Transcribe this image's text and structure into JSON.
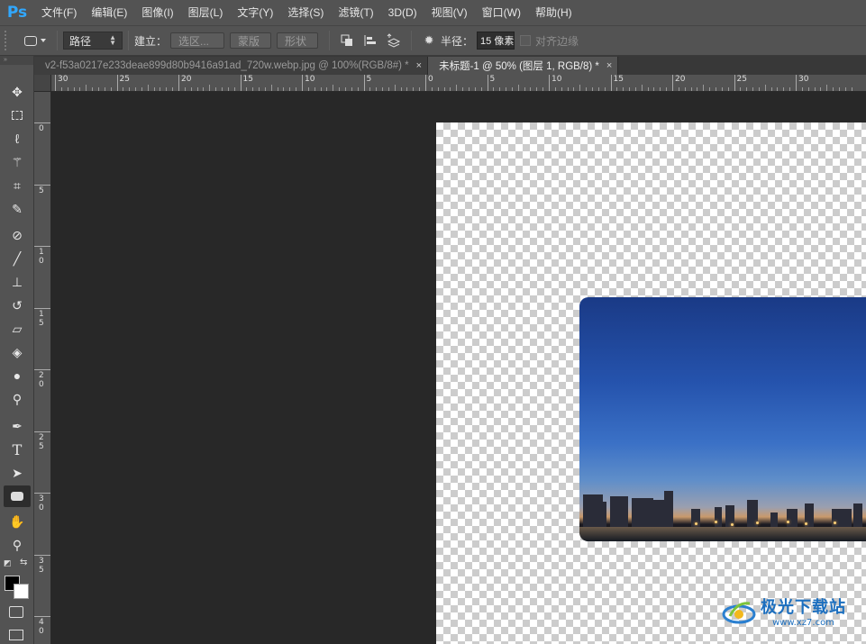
{
  "app": {
    "logo": "Ps"
  },
  "menu": [
    "文件(F)",
    "编辑(E)",
    "图像(I)",
    "图层(L)",
    "文字(Y)",
    "选择(S)",
    "滤镜(T)",
    "3D(D)",
    "视图(V)",
    "窗口(W)",
    "帮助(H)"
  ],
  "options": {
    "mode_value": "路径",
    "make_label": "建立：",
    "selection_btn": "选区...",
    "mask_btn": "蒙版",
    "shape_btn": "形状",
    "radius_label": "半径：",
    "radius_value": "15 像素",
    "align_edges_label": "对齐边缘"
  },
  "tabs": [
    {
      "label": "v2-f53a0217e233deae899d80b9416a91ad_720w.webp.jpg @ 100%(RGB/8#) *",
      "close": "×",
      "active": false
    },
    {
      "label": "未标题-1 @ 50% (图层 1, RGB/8) *",
      "close": "×",
      "active": true
    }
  ],
  "rulers": {
    "h_labels": [
      "30",
      "25",
      "20",
      "15",
      "10",
      "5",
      "0",
      "5",
      "10",
      "15",
      "20",
      "25",
      "30"
    ],
    "v_labels": [
      "0",
      "5",
      "10",
      "15",
      "20",
      "25",
      "30",
      "35",
      "40"
    ]
  },
  "toolbar": {
    "header": "»"
  },
  "watermark": {
    "cn": "极光下载站",
    "url": "www.xz7.com"
  },
  "colors": {
    "accent": "#31a8ff",
    "fg": "#000000",
    "bg": "#ffffff",
    "watermark": "#1c6fbf"
  }
}
